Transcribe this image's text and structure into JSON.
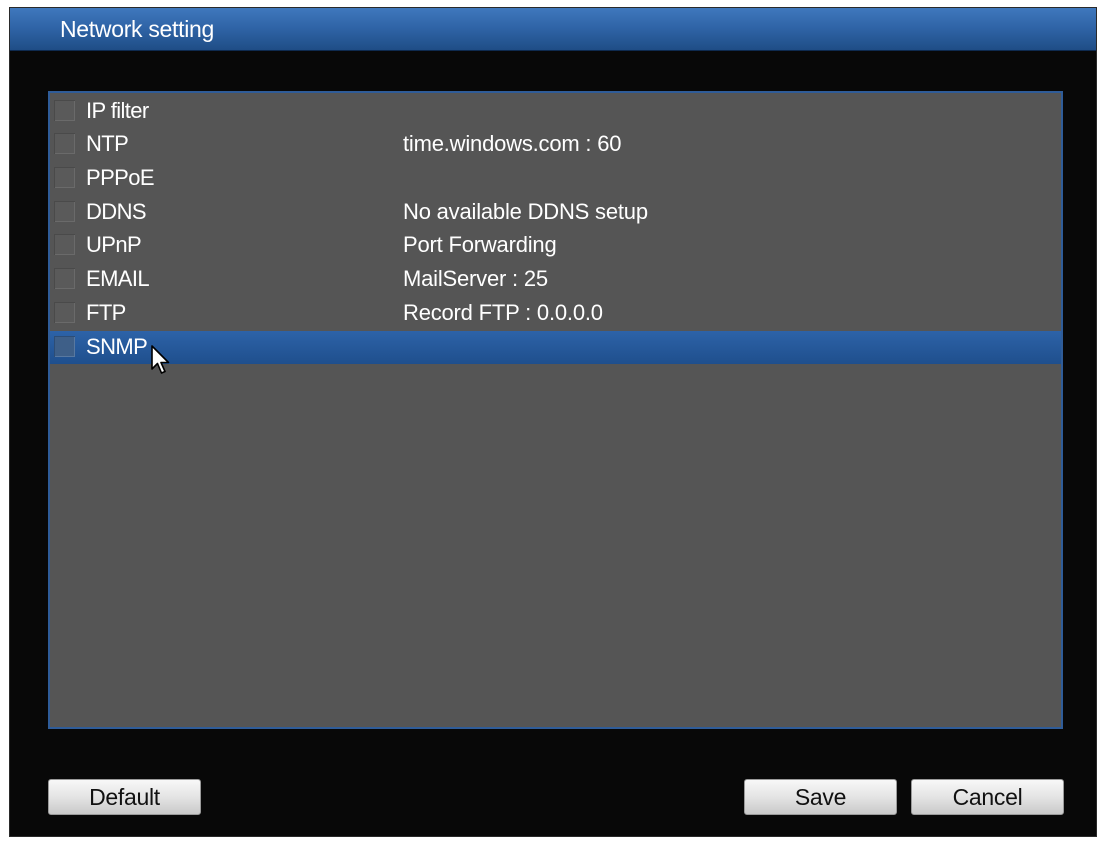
{
  "window": {
    "title": "Network setting"
  },
  "list": {
    "items": [
      {
        "name": "IP filter",
        "value": "",
        "selected": false
      },
      {
        "name": "NTP",
        "value": "time.windows.com : 60",
        "selected": false
      },
      {
        "name": "PPPoE",
        "value": "",
        "selected": false
      },
      {
        "name": "DDNS",
        "value": "No available DDNS setup",
        "selected": false
      },
      {
        "name": "UPnP",
        "value": "Port Forwarding",
        "selected": false
      },
      {
        "name": "EMAIL",
        "value": "MailServer : 25",
        "selected": false
      },
      {
        "name": "FTP",
        "value": "Record FTP : 0.0.0.0",
        "selected": false
      },
      {
        "name": "SNMP",
        "value": "",
        "selected": true
      }
    ]
  },
  "buttons": {
    "default_label": "Default",
    "save_label": "Save",
    "cancel_label": "Cancel"
  },
  "colors": {
    "title_bar": "#2e63a5",
    "selection": "#2559a0",
    "list_background": "#555555",
    "window_background": "#080808"
  },
  "icons": {
    "cursor": "mouse-pointer-icon",
    "checkbox": "checkbox-unchecked-icon"
  }
}
